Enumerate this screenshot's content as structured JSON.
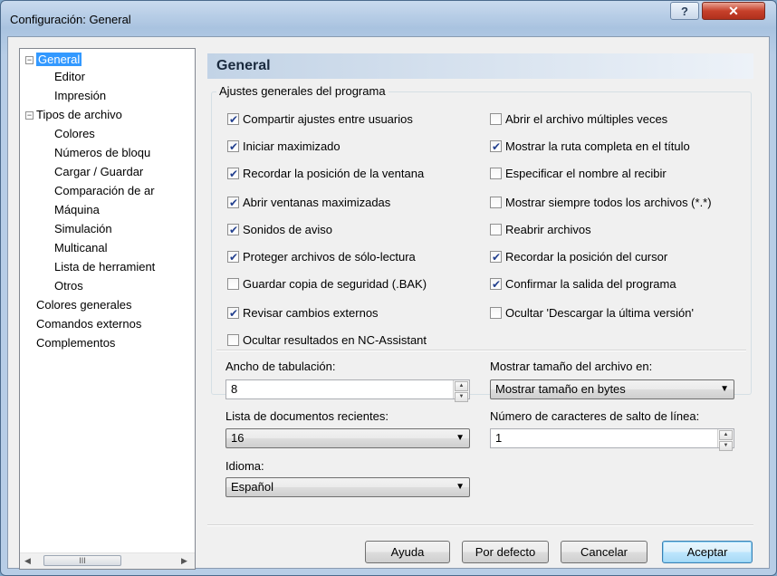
{
  "window": {
    "title": "Configuración: General",
    "help_label": "?",
    "close_label": "✕"
  },
  "tree": {
    "items": [
      {
        "label": "General"
      },
      {
        "label": "Editor"
      },
      {
        "label": "Impresión"
      },
      {
        "label": "Tipos de archivo"
      },
      {
        "label": "Colores"
      },
      {
        "label": "Números de bloqu"
      },
      {
        "label": "Cargar / Guardar"
      },
      {
        "label": "Comparación de ar"
      },
      {
        "label": "Máquina"
      },
      {
        "label": "Simulación"
      },
      {
        "label": "Multicanal"
      },
      {
        "label": "Lista de herramient"
      },
      {
        "label": "Otros"
      },
      {
        "label": "Colores generales"
      },
      {
        "label": "Comandos externos"
      },
      {
        "label": "Complementos"
      }
    ],
    "scroll_thumb": "III",
    "scroll_left": "◀",
    "scroll_right": "▶"
  },
  "panel": {
    "header": "General",
    "group_label": "Ajustes generales del programa",
    "checkboxes_left": [
      {
        "label": "Compartir ajustes entre usuarios",
        "checked": true
      },
      {
        "label": "Iniciar maximizado",
        "checked": true
      },
      {
        "label": "Recordar la posición de la ventana",
        "checked": true
      },
      {
        "label": "Abrir ventanas maximizadas",
        "checked": true
      },
      {
        "label": "Sonidos de aviso",
        "checked": true
      },
      {
        "label": "Proteger archivos de sólo-lectura",
        "checked": true
      },
      {
        "label": "Guardar copia de seguridad (.BAK)",
        "checked": false
      },
      {
        "label": "Revisar cambios externos",
        "checked": true
      },
      {
        "label": "Ocultar resultados en NC-Assistant",
        "checked": false
      }
    ],
    "checkboxes_right": [
      {
        "label": "Abrir el archivo múltiples veces",
        "checked": false
      },
      {
        "label": "Mostrar la ruta completa en el título",
        "checked": true
      },
      {
        "label": "Especificar el nombre al recibir",
        "checked": false
      },
      {
        "label": "Mostrar siempre todos los archivos (*.*)",
        "checked": false
      },
      {
        "label": "Reabrir archivos",
        "checked": false
      },
      {
        "label": "Recordar la posición del cursor",
        "checked": true
      },
      {
        "label": "Confirmar la salida del programa",
        "checked": true
      },
      {
        "label": "Ocultar 'Descargar la última versión'",
        "checked": false
      }
    ],
    "tab_width_label": "Ancho de tabulación:",
    "tab_width_value": "8",
    "recent_docs_label": "Lista de documentos recientes:",
    "recent_docs_value": "16",
    "language_label": "Idioma:",
    "language_value": "Español",
    "file_size_label": "Mostrar tamaño del archivo en:",
    "file_size_value": "Mostrar tamaño en bytes",
    "line_break_label": "Número de caracteres de salto de línea:",
    "line_break_value": "1"
  },
  "buttons": {
    "help": "Ayuda",
    "default": "Por defecto",
    "cancel": "Cancelar",
    "accept": "Aceptar"
  },
  "colors": {
    "selection": "#3399ff",
    "header_gradient_start": "#c2d3e6",
    "close_button": "#c7412b"
  }
}
